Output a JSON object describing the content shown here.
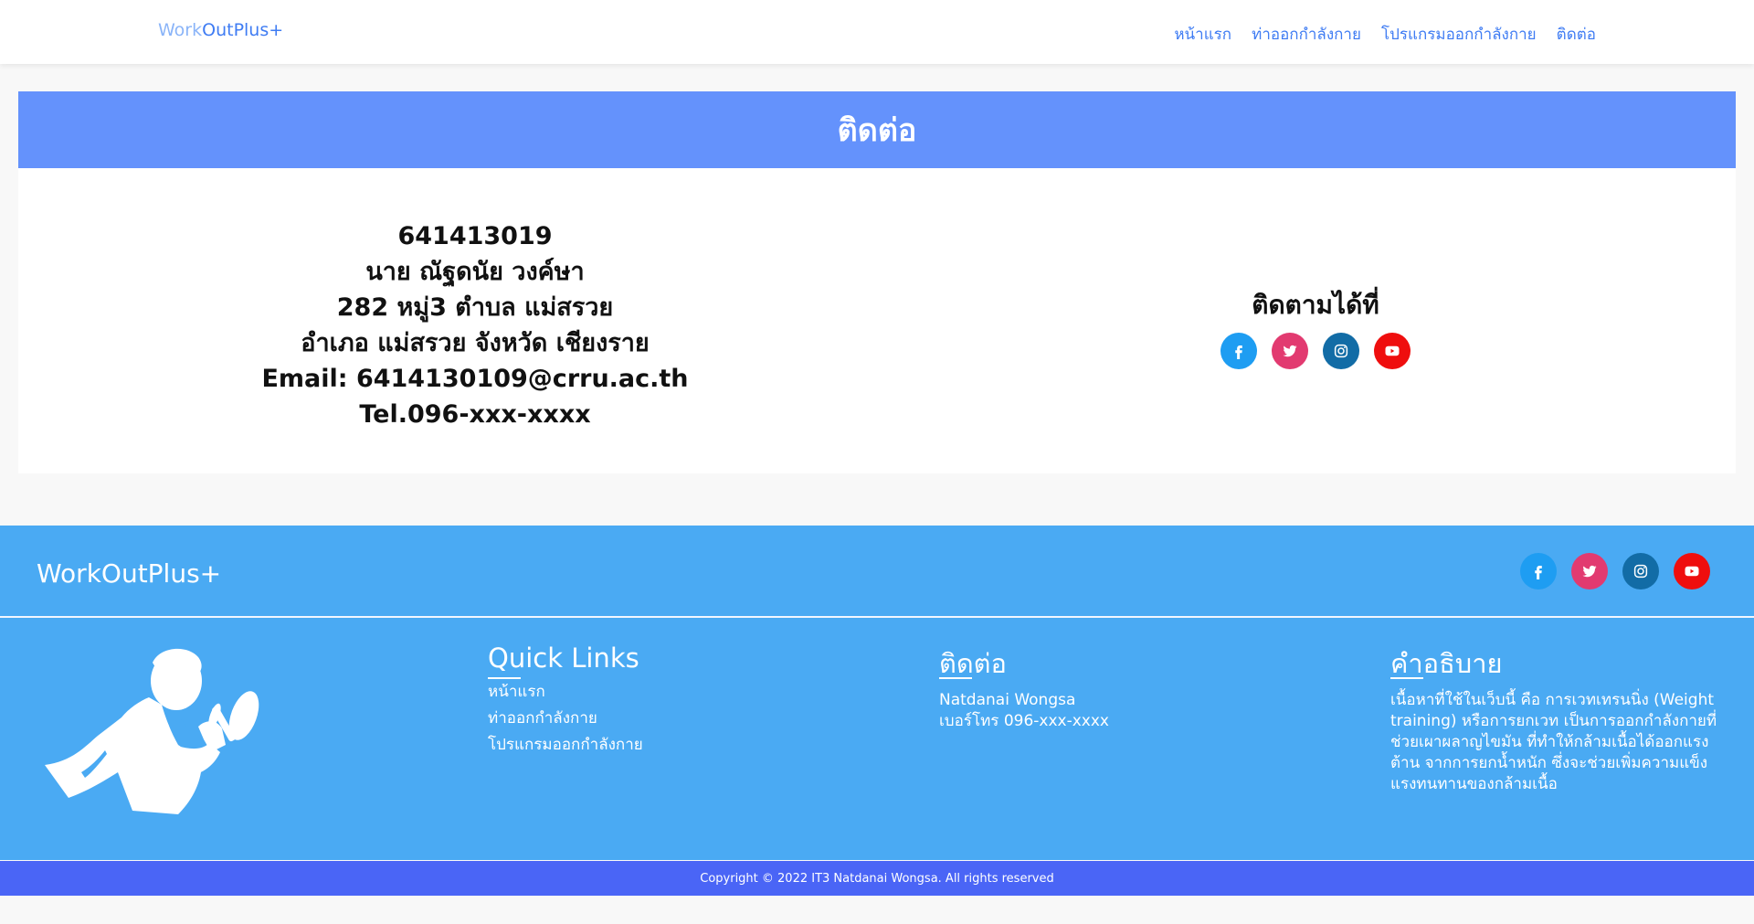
{
  "navbar": {
    "brand_part1": "Work",
    "brand_part2": "OutPlus+",
    "links": [
      "หน้าแรก",
      "ท่าออกกำลังกาย",
      "โปรแกรมออกกำลังกาย",
      "ติดต่อ"
    ]
  },
  "banner": {
    "title": "ติดต่อ"
  },
  "contact": {
    "lines": [
      "641413019",
      "นาย ณัฐดนัย วงค์ษา",
      "282 หมู่3 ตำบล แม่สรวย",
      "อำเภอ แม่สรวย จังหวัด เชียงราย",
      "Email: 6414130109@crru.ac.th",
      "Tel.096-xxx-xxxx"
    ],
    "follow_title": "ติดตามได้ที่"
  },
  "social_icons": [
    "facebook-icon",
    "twitter-icon",
    "instagram-icon",
    "youtube-icon"
  ],
  "colors": {
    "primary_blue": "#3f7cf3",
    "banner": "#6492fc",
    "footer": "#4aaaf3",
    "copyright_bar": "#4a65f6",
    "facebook": "#1e9df2",
    "twitter": "#e23a70",
    "instagram": "#126ca6",
    "youtube": "#ef0e0e"
  },
  "footer": {
    "brand": "WorkOutPlus+",
    "quick_links": {
      "title": "Quick Links",
      "items": [
        "หน้าแรก",
        "ท่าออกกำลังกาย",
        "โปรแกรมออกกำลังกาย"
      ]
    },
    "contact": {
      "title": "ติดต่อ",
      "items": [
        "Natdanai Wongsa",
        "เบอร์โทร 096-xxx-xxxx"
      ]
    },
    "description": {
      "title": "คำอธิบาย",
      "text": "เนื้อหาที่ใช้ในเว็บนี้ คือ การเวทเทรนนิ่ง (Weight training) หรือการยกเวท เป็นการออกกำลังกายที่ช่วยเผาผลาญไขมัน ที่ทำให้กล้ามเนื้อได้ออกแรงต้าน จากการยกน้ำหนัก ซึ่งจะช่วยเพิ่มความแข็งแรงทนทานของกล้ามเนื้อ"
    },
    "copyright": "Copyright © 2022 IT3 Natdanai Wongsa. All rights reserved"
  }
}
